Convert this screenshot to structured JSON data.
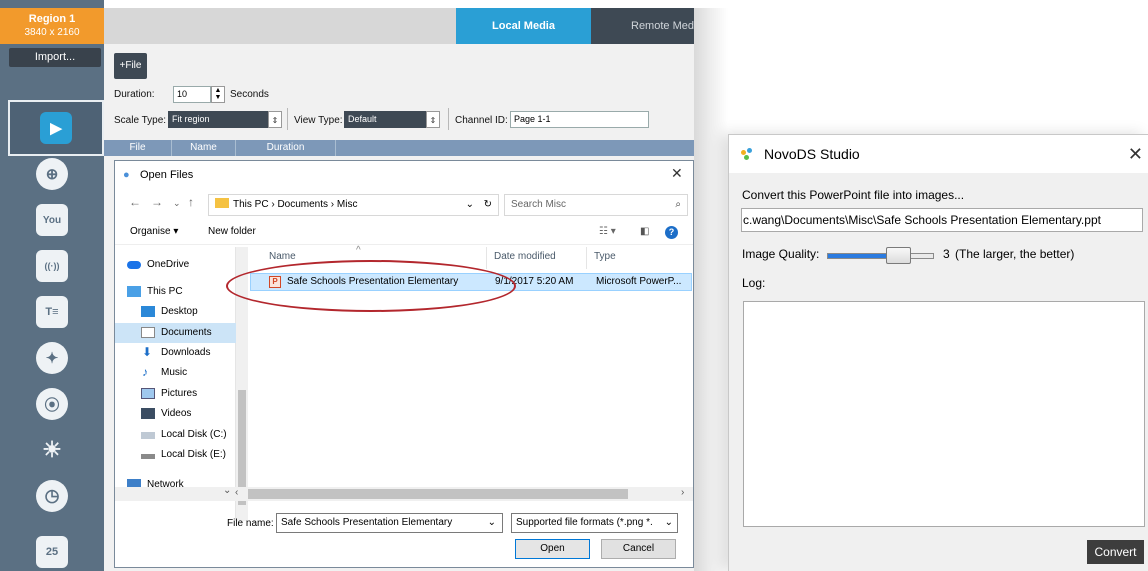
{
  "region": {
    "name": "Region 1",
    "resolution": "3840 x 2160"
  },
  "import_label": "Import...",
  "tabs": {
    "local": "Local Media",
    "remote": "Remote Media"
  },
  "sidebar": {
    "items": [
      {
        "name": "slide",
        "glyph": "▶"
      },
      {
        "name": "web",
        "glyph": "⊕"
      },
      {
        "name": "youtube",
        "glyph": "You"
      },
      {
        "name": "stream",
        "glyph": "((·))"
      },
      {
        "name": "text",
        "glyph": "T≡"
      },
      {
        "name": "twitter",
        "glyph": "✦"
      },
      {
        "name": "rss",
        "glyph": "⦿"
      },
      {
        "name": "weather",
        "glyph": "☀"
      },
      {
        "name": "clock",
        "glyph": "◷"
      },
      {
        "name": "calendar",
        "glyph": "25"
      }
    ]
  },
  "form": {
    "file_button": "+File",
    "duration_label": "Duration:",
    "duration_value": "10",
    "seconds_label": "Seconds",
    "scale_type_label": "Scale Type:",
    "scale_type_value": "Fit region",
    "view_type_label": "View Type:",
    "view_type_value": "Default",
    "channel_id_label": "Channel ID:",
    "channel_id_value": "Page 1-1"
  },
  "table": {
    "columns": [
      "File",
      "Name",
      "Duration"
    ]
  },
  "open_dialog": {
    "title": "Open Files",
    "breadcrumb": "This PC  ›  Documents  ›  Misc",
    "search_placeholder": "Search Misc",
    "organise": "Organise ▾",
    "new_folder": "New folder",
    "nav": [
      "OneDrive",
      "This PC",
      "Desktop",
      "Documents",
      "Downloads",
      "Music",
      "Pictures",
      "Videos",
      "Local Disk (C:)",
      "Local Disk (E:)",
      "Network"
    ],
    "columns": {
      "name": "Name",
      "date": "Date modified",
      "type": "Type"
    },
    "file": {
      "name": "Safe Schools Presentation Elementary",
      "date": "9/1/2017 5:20 AM",
      "type": "Microsoft PowerP..."
    },
    "file_name_label": "File name:",
    "file_name_value": "Safe Schools Presentation Elementary",
    "file_type_value": "Supported file formats (*.png *.",
    "open": "Open",
    "cancel": "Cancel"
  },
  "novo": {
    "title": "NovoDS Studio",
    "message": "Convert this PowerPoint file into images...",
    "path": "c.wang\\Documents\\Misc\\Safe Schools Presentation Elementary.ppt",
    "quality_label": "Image Quality:",
    "quality_value": "3",
    "quality_hint": "(The larger, the better)",
    "quality_level": 3,
    "quality_max": 5,
    "log_label": "Log:",
    "convert": "Convert"
  },
  "colors": {
    "sidebar": "#5b7083",
    "region_orange": "#f29a2c",
    "local_tab_blue": "#2a9fd5",
    "highlight_red": "#b3272d"
  }
}
